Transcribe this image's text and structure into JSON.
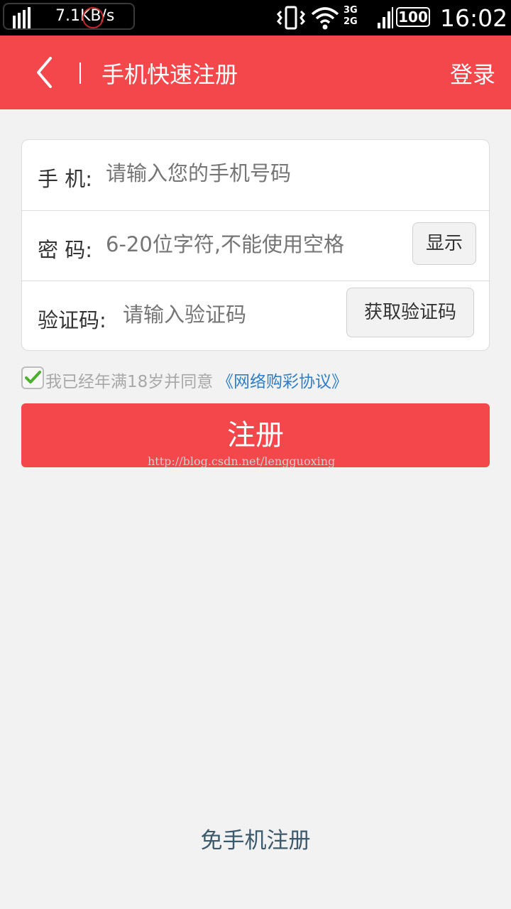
{
  "status_bar": {
    "net_speed": "7.1KB/s",
    "network_types": [
      "3G",
      "2G"
    ],
    "battery": "100",
    "time": "16:02"
  },
  "header": {
    "title": "手机快速注册",
    "login_label": "登录",
    "background_color": "#f3474c"
  },
  "form": {
    "phone": {
      "label": "手 机:",
      "placeholder": "请输入您的手机号码"
    },
    "password": {
      "label": "密 码:",
      "placeholder": "6-20位字符,不能使用空格",
      "show_button": "显示"
    },
    "code": {
      "label": "验证码:",
      "placeholder": "请输入验证码",
      "get_code_button": "获取验证码"
    }
  },
  "agreement": {
    "checked": true,
    "text": "我已经年满18岁并同意",
    "link_text": "《网络购彩协议》"
  },
  "register_button": "注册",
  "watermark": "http://blog.csdn.net/lengguoxing",
  "bottom_link": "免手机注册"
}
